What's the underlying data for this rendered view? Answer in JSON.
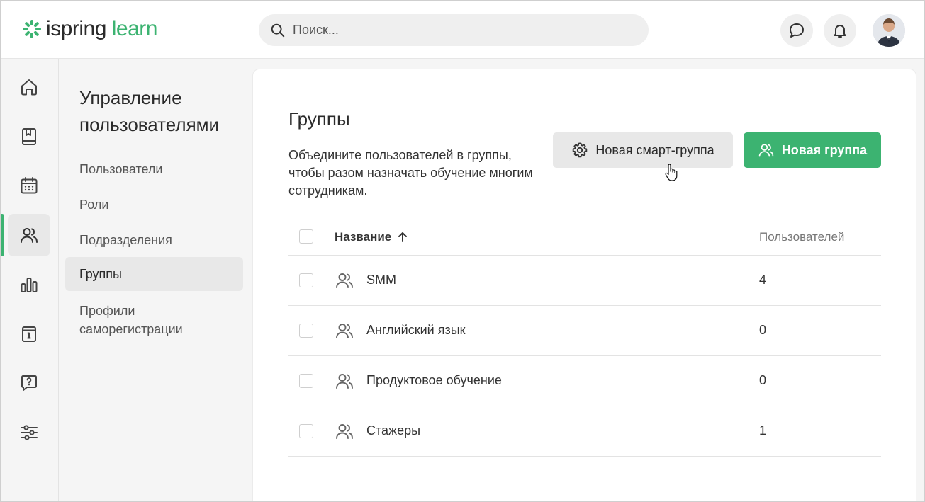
{
  "header": {
    "logo_part1": "ispring",
    "logo_part2": "learn",
    "search_placeholder": "Поиск...",
    "icons": [
      "search-icon",
      "chat-icon",
      "bell-icon"
    ],
    "brand_color": "#3cb371"
  },
  "rail": {
    "items": [
      "home-icon",
      "book-icon",
      "calendar-icon",
      "users-icon",
      "chart-icon",
      "info-card-icon",
      "question-icon",
      "sliders-icon"
    ],
    "active_index": 3
  },
  "subnav": {
    "title": "Управление пользователями",
    "items": [
      {
        "label": "Пользователи"
      },
      {
        "label": "Роли"
      },
      {
        "label": "Подразделения"
      },
      {
        "label": "Группы"
      },
      {
        "label": "Профили саморегистрации"
      }
    ],
    "active_index": 3
  },
  "main": {
    "title": "Группы",
    "description": "Объедините пользователей в группы, чтобы разом назначать обучение многим сотрудникам.",
    "smart_group_button": "Новая смарт-группа",
    "new_group_button": "Новая группа",
    "table": {
      "col_name": "Название",
      "col_users": "Пользователей",
      "rows": [
        {
          "name": "SMM",
          "users": "4"
        },
        {
          "name": "Английский язык",
          "users": "0"
        },
        {
          "name": "Продуктовое обучение",
          "users": "0"
        },
        {
          "name": "Стажеры",
          "users": "1"
        }
      ]
    }
  }
}
